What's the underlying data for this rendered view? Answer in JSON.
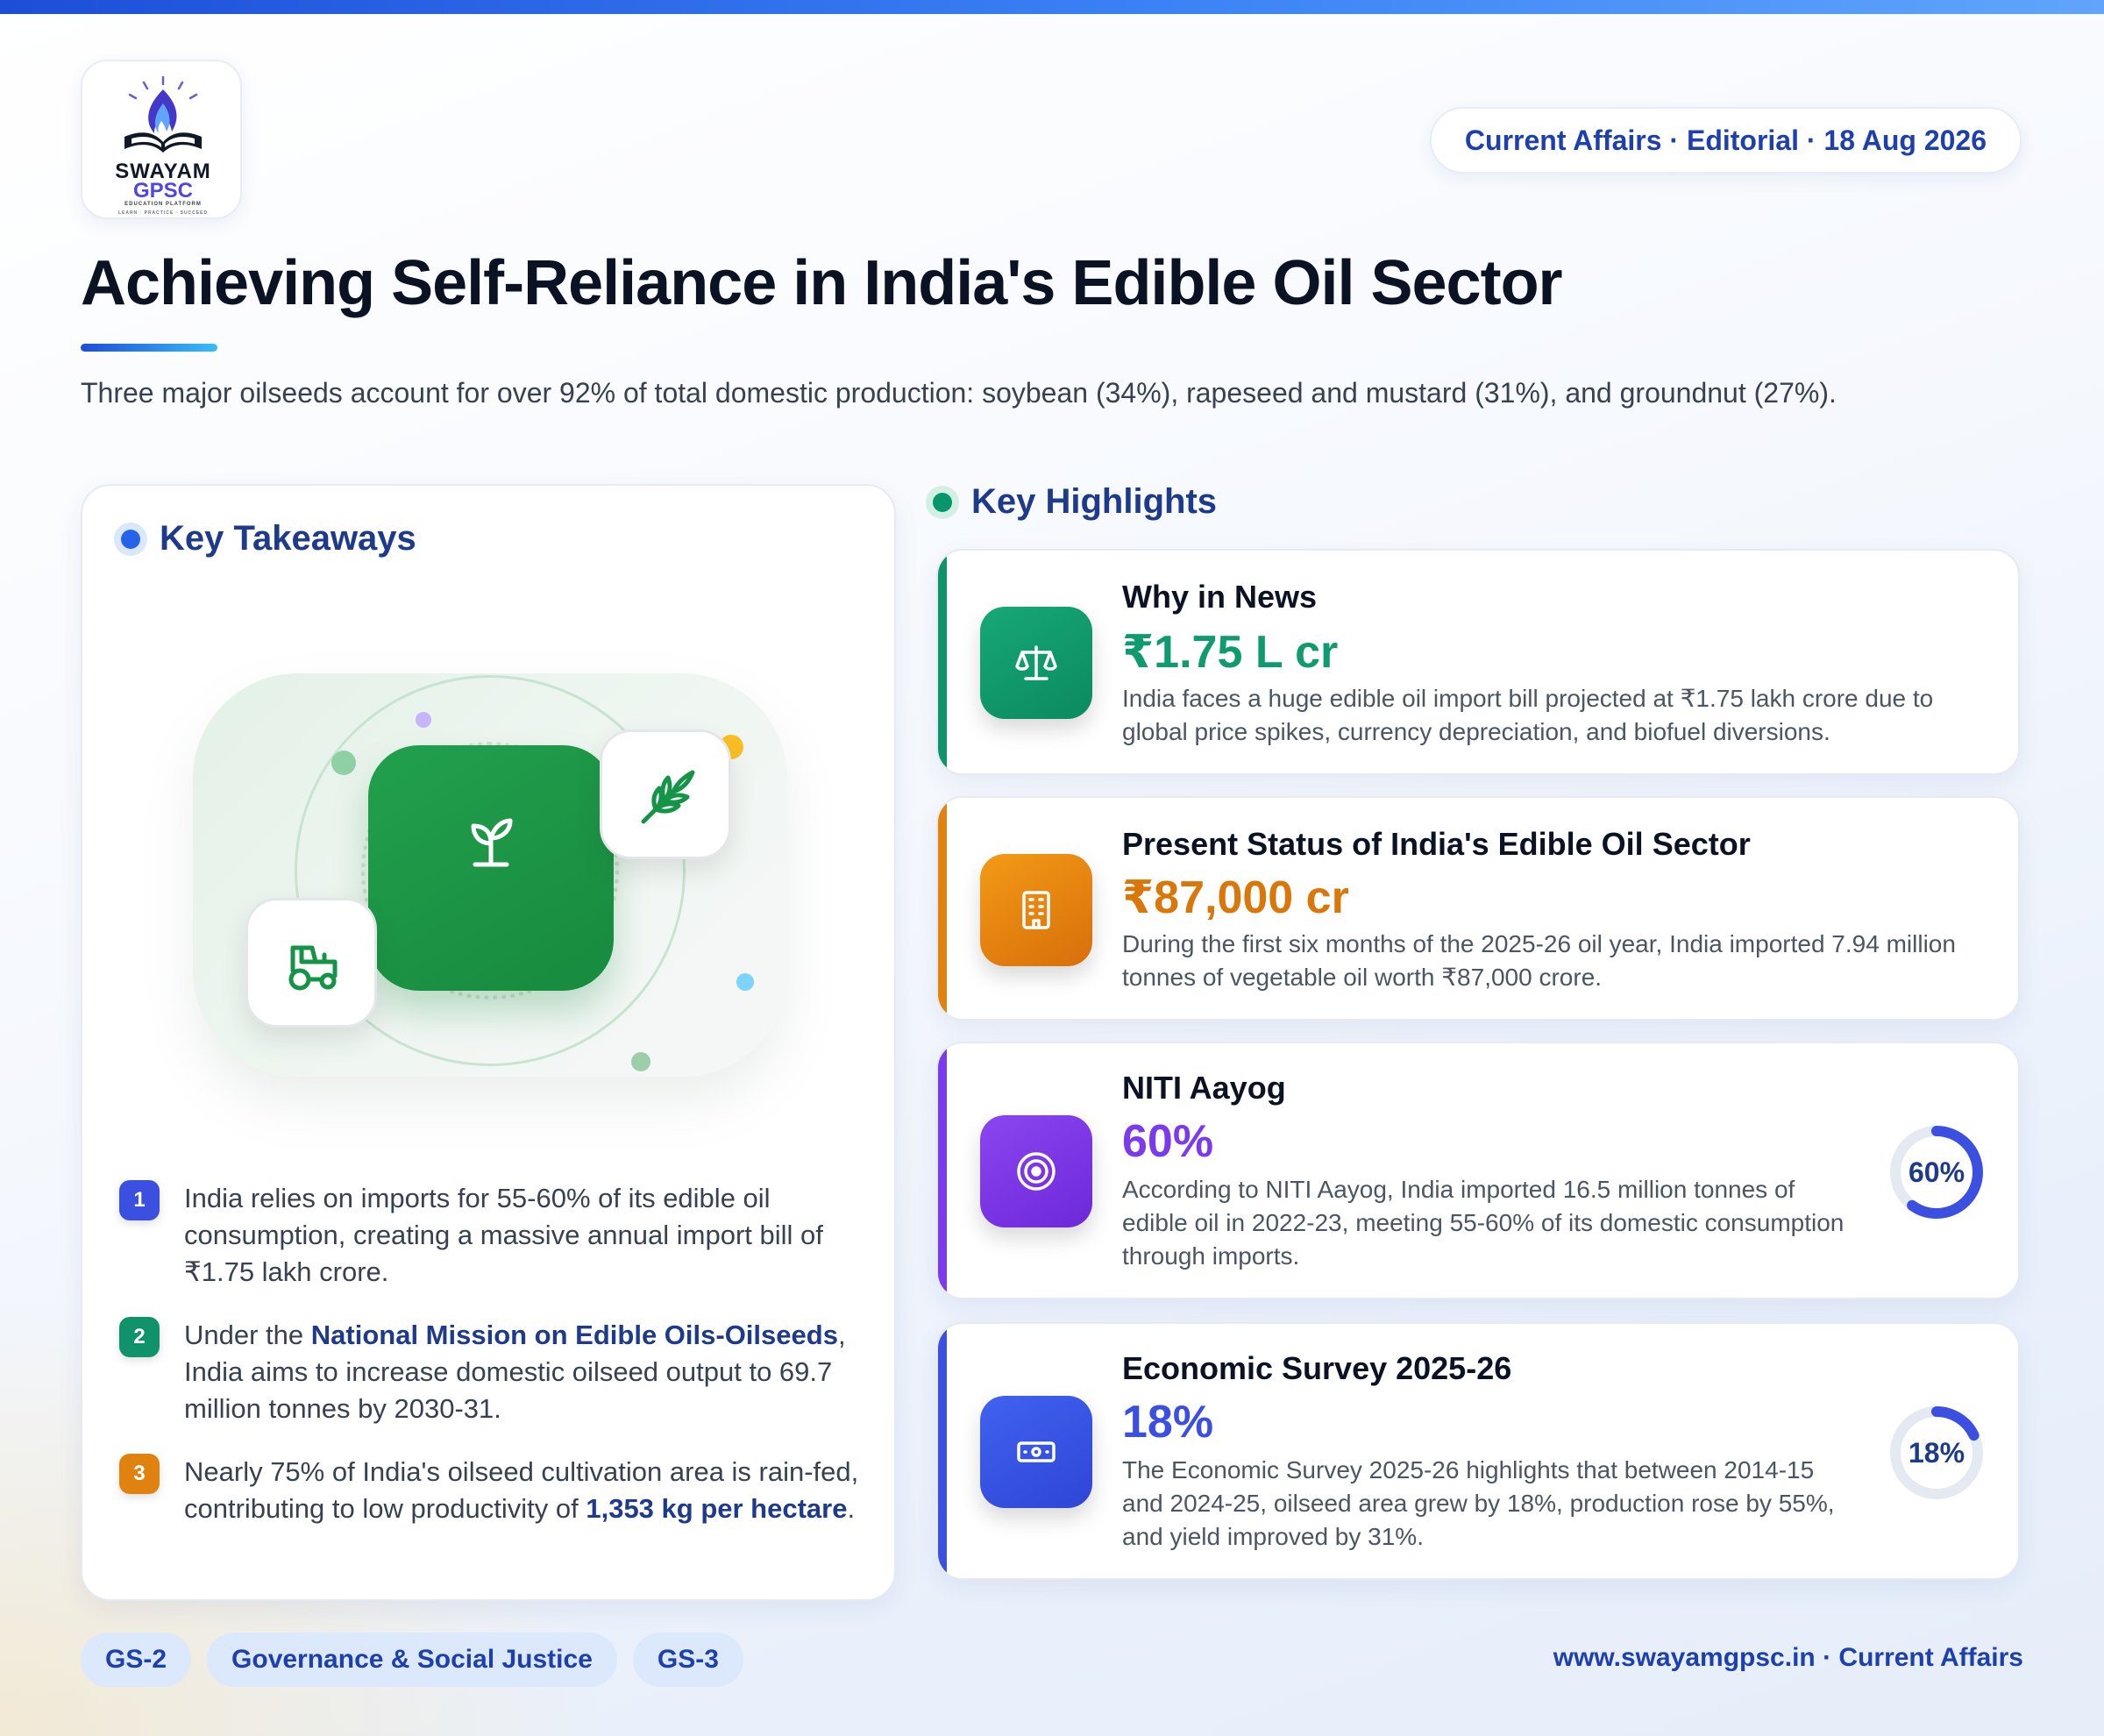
{
  "brand": {
    "logo_line1": "SWAYAM",
    "logo_line2": "GPSC",
    "logo_line3": "EDUCATION PLATFORM",
    "logo_line4": "LEARN · PRACTICE · SUCCEED"
  },
  "header": {
    "date_pill": "Current Affairs · Editorial · 18 Aug 2026",
    "title": "Achieving Self-Reliance in India's Edible Oil Sector",
    "subtitle": "Three major oilseeds account for over 92% of total domestic production: soybean (34%), rapeseed and mustard (31%), and groundnut (27%)."
  },
  "takeaways": {
    "heading": "Key Takeaways",
    "items": [
      {
        "num": "1",
        "color": "#3b4fe0",
        "pre": "India relies on imports for 55-60% of its edible oil consumption, creating a massive annual import bill of ₹1.75 lakh crore.",
        "bold": "",
        "post": ""
      },
      {
        "num": "2",
        "color": "#10936b",
        "pre": "Under the ",
        "bold": "National Mission on Edible Oils-Oilseeds",
        "post": ", India aims to increase domestic oilseed output to 69.7 million tonnes by 2030-31."
      },
      {
        "num": "3",
        "color": "#e0820f",
        "pre": "Nearly 75% of India's oilseed cultivation area is rain-fed, contributing to low productivity of ",
        "bold": "1,353 kg per hectare",
        "post": "."
      }
    ],
    "illustration_icons": [
      "sprout-icon",
      "wheat-icon",
      "tractor-icon"
    ]
  },
  "highlights": {
    "heading": "Key Highlights",
    "cards": [
      {
        "title": "Why in News",
        "value": "₹1.75 L cr",
        "value_color": "#0f9b6e",
        "accent": "#10936b",
        "icon": "scale-icon",
        "desc": "India faces a huge edible oil import bill projected at ₹1.75 lakh crore due to global price spikes, currency depreciation, and biofuel diversions."
      },
      {
        "title": "Present Status of India's Edible Oil Sector",
        "value": "₹87,000 cr",
        "value_color": "#d9770a",
        "accent": "#e0820f",
        "icon": "building-icon",
        "desc": "During the first six months of the 2025-26 oil year, India imported 7.94 million tonnes of vegetable oil worth ₹87,000 crore."
      },
      {
        "title": "NITI Aayog",
        "value": "60%",
        "value_color": "#7c3aed",
        "accent": "#7c3aed",
        "icon": "target-icon",
        "desc": "According to NITI Aayog, India imported 16.5 million tonnes of edible oil in 2022-23, meeting 55-60% of its domestic consumption through imports.",
        "donut_label": "60%",
        "donut_fraction": 0.6
      },
      {
        "title": "Economic Survey 2025-26",
        "value": "18%",
        "value_color": "#3b4fe0",
        "accent": "#3b4fe0",
        "icon": "cash-icon",
        "desc": "The Economic Survey 2025-26 highlights that between 2014-15 and 2024-25, oilseed area grew by 18%, production rose by 55%, and yield improved by 31%.",
        "donut_label": "18%",
        "donut_fraction": 0.18
      }
    ]
  },
  "footer": {
    "tags": [
      "GS-2",
      "Governance & Social Justice",
      "GS-3"
    ],
    "site": "www.swayamgpsc.in · Current Affairs"
  }
}
